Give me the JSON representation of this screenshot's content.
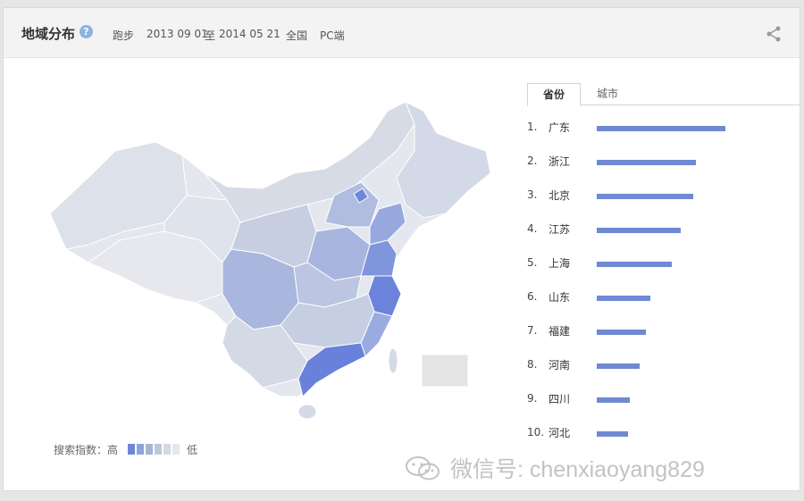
{
  "header": {
    "title": "地域分布",
    "help_icon": "help-icon",
    "keyword": "跑步",
    "date_start": "2013 09 01",
    "date_to": "至",
    "date_end": "2014 05 21",
    "region": "全国",
    "platform": "PC端",
    "share_icon": "share-icon"
  },
  "tabs": [
    {
      "label": "省份",
      "active": true
    },
    {
      "label": "城市",
      "active": false
    }
  ],
  "ranking": [
    {
      "rank": "1.",
      "name": "广东",
      "value": 1.0
    },
    {
      "rank": "2.",
      "name": "浙江",
      "value": 0.77
    },
    {
      "rank": "3.",
      "name": "北京",
      "value": 0.75
    },
    {
      "rank": "4.",
      "name": "江苏",
      "value": 0.65
    },
    {
      "rank": "5.",
      "name": "上海",
      "value": 0.58
    },
    {
      "rank": "6.",
      "name": "山东",
      "value": 0.42
    },
    {
      "rank": "7.",
      "name": "福建",
      "value": 0.38
    },
    {
      "rank": "8.",
      "name": "河南",
      "value": 0.33
    },
    {
      "rank": "9.",
      "name": "四川",
      "value": 0.26
    },
    {
      "rank": "10.",
      "name": "河北",
      "value": 0.24
    }
  ],
  "legend": {
    "label": "搜索指数：高",
    "low": "低",
    "swatch_colors": [
      "#6d87d6",
      "#8ea2dc",
      "#a6b4da",
      "#bfc7db",
      "#d3d8e1",
      "#e4e7ec"
    ]
  },
  "map_colors": {
    "base": "#e4e7ed",
    "light": "#d3d9e6",
    "mid": "#b8c2df",
    "midstrong": "#9aaade",
    "strong": "#7b92dd",
    "strongest": "#6981db"
  },
  "watermark": {
    "text": "微信号: chenxiaoyang829",
    "icon": "wechat-icon"
  }
}
